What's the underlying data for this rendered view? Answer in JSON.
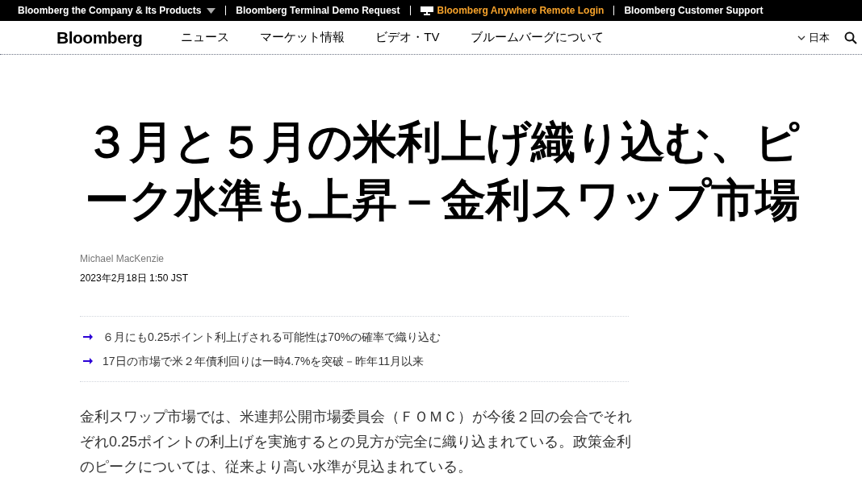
{
  "top_bar": {
    "links": [
      {
        "label": "Bloomberg the Company & Its Products",
        "kind": "dropdown"
      },
      {
        "label": "Bloomberg Terminal Demo Request",
        "kind": "plain"
      },
      {
        "label": "Bloomberg Anywhere Remote Login",
        "kind": "highlight"
      },
      {
        "label": "Bloomberg Customer Support",
        "kind": "plain"
      }
    ]
  },
  "nav": {
    "logo": "Bloomberg",
    "items": [
      "ニュース",
      "マーケット情報",
      "ビデオ・TV",
      "ブルームバーグについて"
    ],
    "language": "日本"
  },
  "article": {
    "headline": "３月と５月の米利上げ織り込む、ピーク水準も上昇－金利スワップ市場",
    "author": "Michael MacKenzie",
    "date": "2023年2月18日 1:50 JST",
    "bullets": [
      "６月にも0.25ポイント利上げされる可能性は70%の確率で織り込む",
      "17日の市場で米２年債利回りは一時4.7%を突破－昨年11月以来"
    ],
    "body": "金利スワップ市場では、米連邦公開市場委員会（ＦＯＭＣ）が今後２回の会合でそれぞれ0.25ポイントの利上げを実施するとの見方が完全に織り込まれている。政策金利のピークについては、従来より高い水準が見込まれている。"
  }
}
